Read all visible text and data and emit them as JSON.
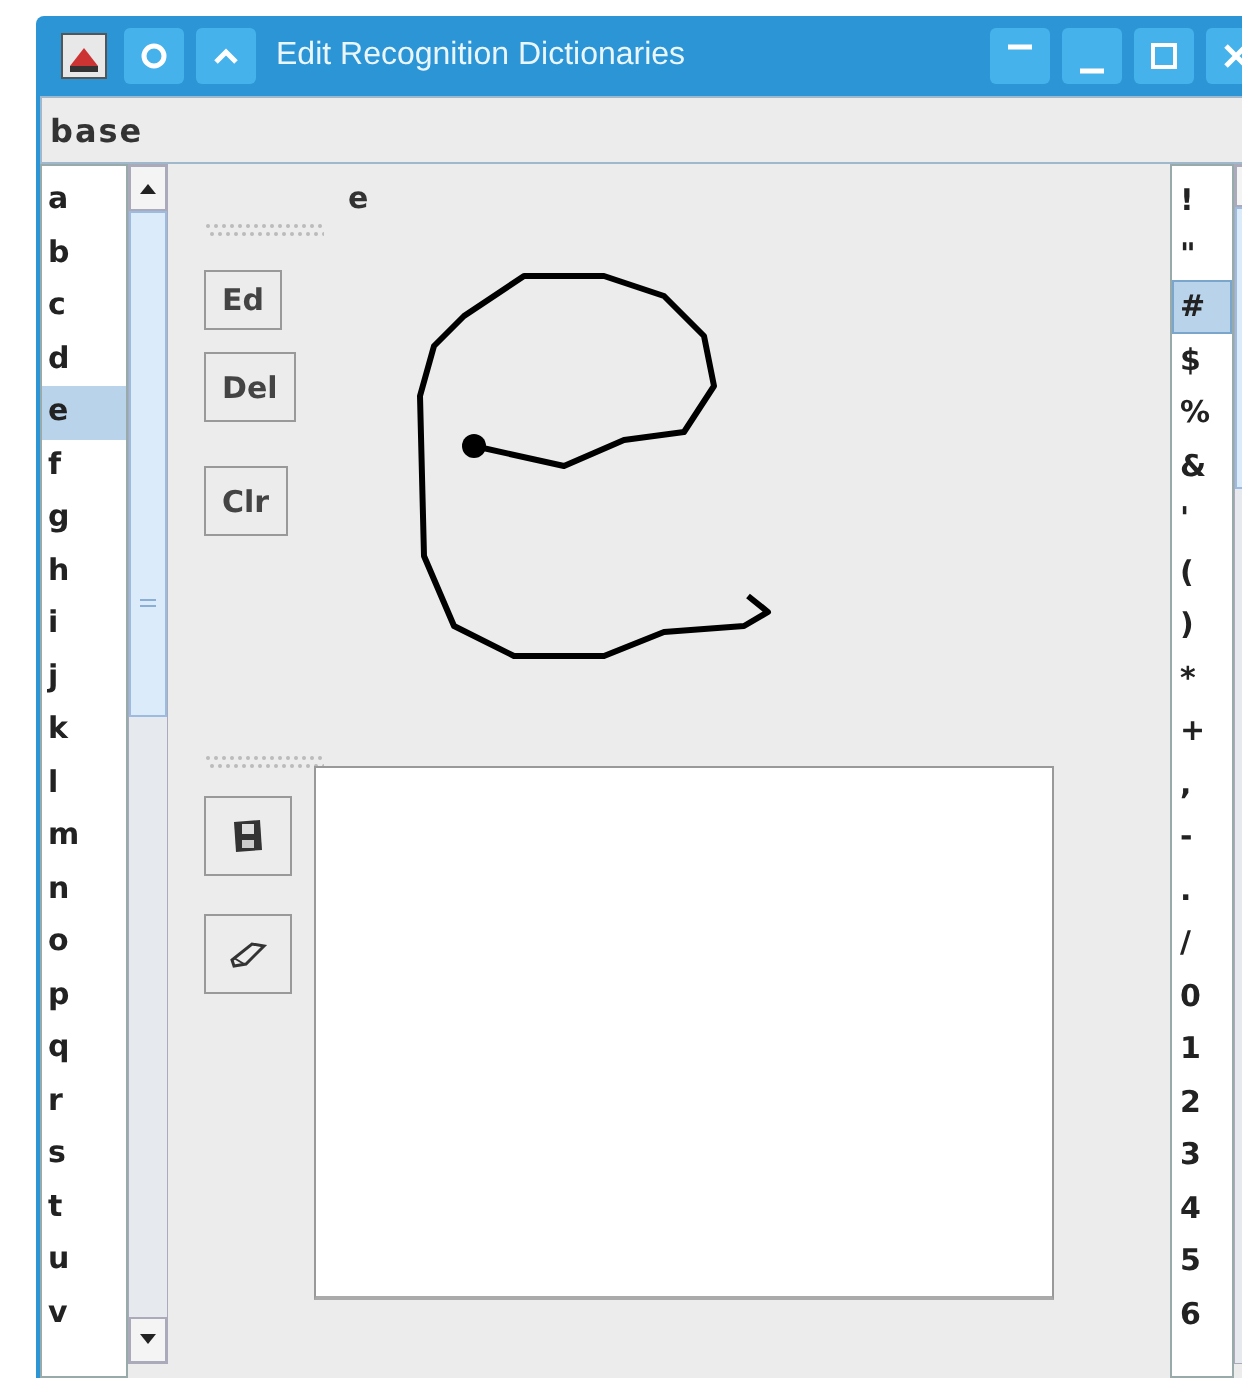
{
  "window": {
    "title": "Edit Recognition Dictionaries"
  },
  "dictionary_select": {
    "value": "base"
  },
  "letter_list": [
    {
      "label": "a",
      "selected": false
    },
    {
      "label": "b",
      "selected": false
    },
    {
      "label": "c",
      "selected": false
    },
    {
      "label": "d",
      "selected": false
    },
    {
      "label": "e",
      "selected": true
    },
    {
      "label": "f",
      "selected": false
    },
    {
      "label": "g",
      "selected": false
    },
    {
      "label": "h",
      "selected": false
    },
    {
      "label": "i",
      "selected": false
    },
    {
      "label": "j",
      "selected": false
    },
    {
      "label": "k",
      "selected": false
    },
    {
      "label": "l",
      "selected": false
    },
    {
      "label": "m",
      "selected": false
    },
    {
      "label": "n",
      "selected": false
    },
    {
      "label": "o",
      "selected": false
    },
    {
      "label": "p",
      "selected": false
    },
    {
      "label": "q",
      "selected": false
    },
    {
      "label": "r",
      "selected": false
    },
    {
      "label": "s",
      "selected": false
    },
    {
      "label": "t",
      "selected": false
    },
    {
      "label": "u",
      "selected": false
    },
    {
      "label": "v",
      "selected": false
    }
  ],
  "glyph_label": "e",
  "buttons": [
    "Ed",
    "Del",
    "Clr"
  ],
  "symbol_list": [
    {
      "label": "!",
      "selected": false
    },
    {
      "label": "\"",
      "selected": false
    },
    {
      "label": "#",
      "selected": true
    },
    {
      "label": "$",
      "selected": false
    },
    {
      "label": "%",
      "selected": false
    },
    {
      "label": "&",
      "selected": false
    },
    {
      "label": "'",
      "selected": false
    },
    {
      "label": "(",
      "selected": false
    },
    {
      "label": ")",
      "selected": false
    },
    {
      "label": "*",
      "selected": false
    },
    {
      "label": "+",
      "selected": false
    },
    {
      "label": ",",
      "selected": false
    },
    {
      "label": "-",
      "selected": false
    },
    {
      "label": ".",
      "selected": false
    },
    {
      "label": "/",
      "selected": false
    },
    {
      "label": "0",
      "selected": false
    },
    {
      "label": "1",
      "selected": false
    },
    {
      "label": "2",
      "selected": false
    },
    {
      "label": "3",
      "selected": false
    },
    {
      "label": "4",
      "selected": false
    },
    {
      "label": "5",
      "selected": false
    },
    {
      "label": "6",
      "selected": false
    }
  ]
}
